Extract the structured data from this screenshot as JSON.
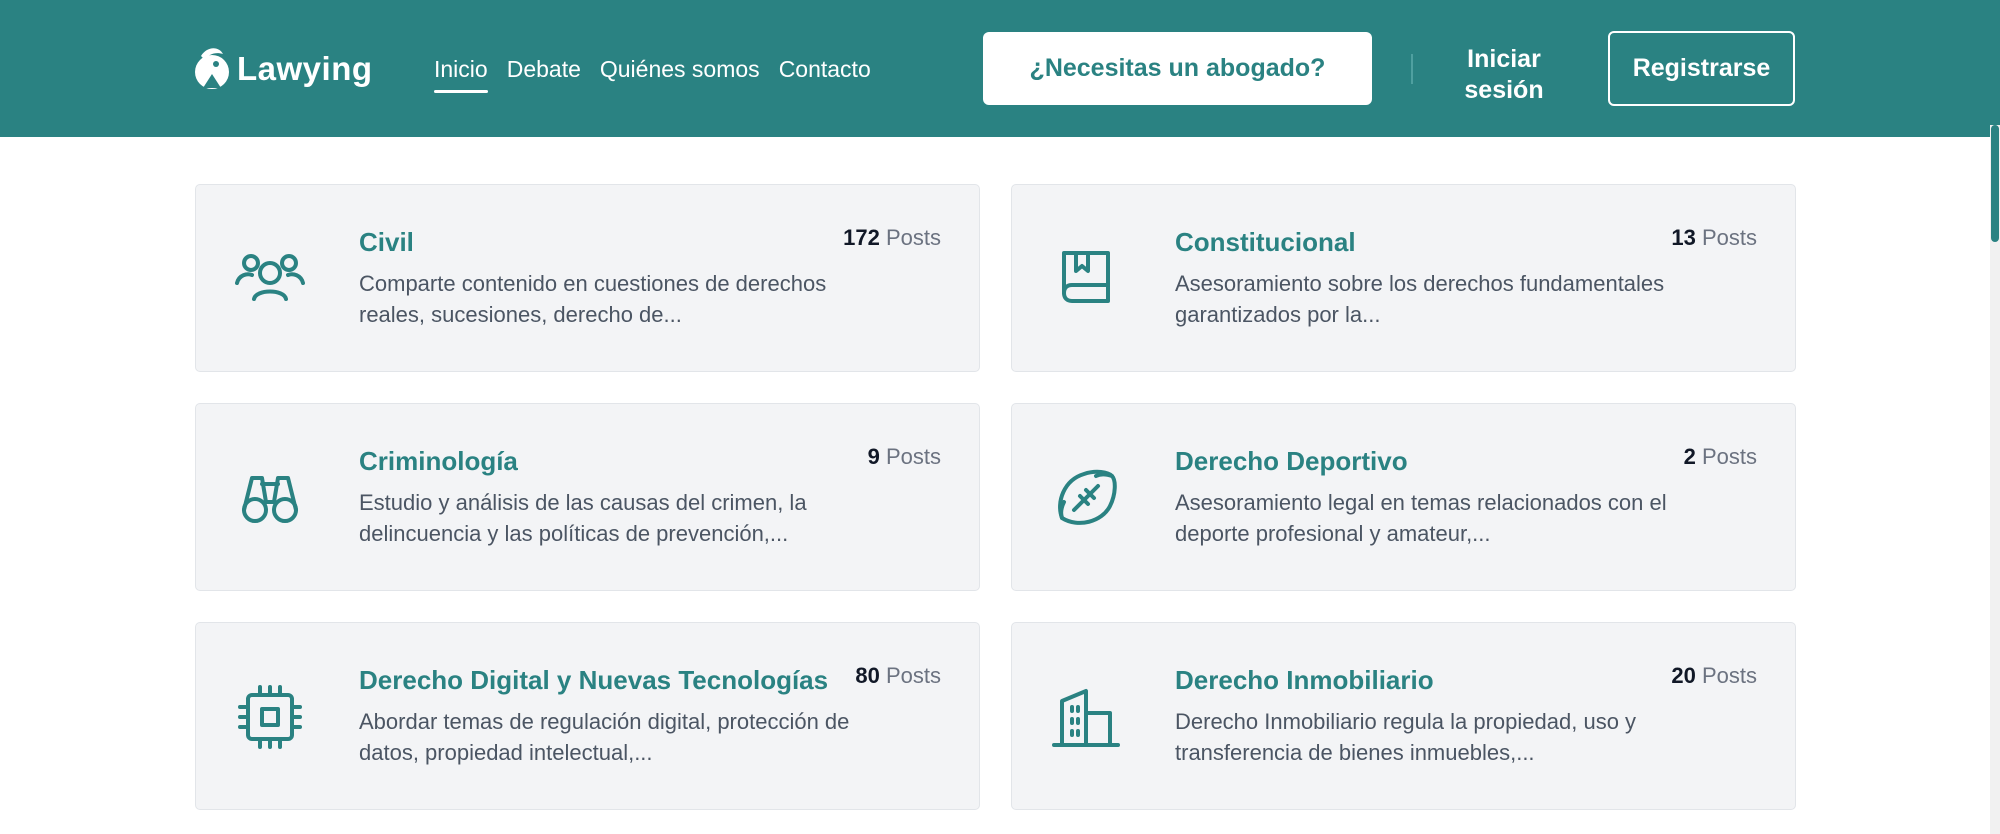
{
  "header": {
    "logo_text": "Lawying",
    "nav": [
      {
        "label": "Inicio",
        "active": true
      },
      {
        "label": "Debate",
        "active": false
      },
      {
        "label": "Quiénes somos",
        "active": false
      },
      {
        "label": "Contacto",
        "active": false
      }
    ],
    "cta_label": "¿Necesitas un abogado?",
    "login_line1": "Iniciar",
    "login_line2": "sesión",
    "register_label": "Registrarse"
  },
  "colors": {
    "brand": "#2a8282",
    "card_bg": "#f3f4f6",
    "text_muted": "#4b5563"
  },
  "posts_label": "Posts",
  "categories": [
    {
      "title": "Civil",
      "count": "172",
      "icon": "users-icon",
      "desc": "Comparte contenido en cuestiones de derechos reales, sucesiones, derecho de..."
    },
    {
      "title": "Constitucional",
      "count": "13",
      "icon": "book-icon",
      "desc": "Asesoramiento sobre los derechos fundamentales garantizados por la..."
    },
    {
      "title": "Criminología",
      "count": "9",
      "icon": "binoculars-icon",
      "desc": "Estudio y análisis de las causas del crimen, la delincuencia y las políticas de prevención,..."
    },
    {
      "title": "Derecho Deportivo",
      "count": "2",
      "icon": "football-icon",
      "desc": "Asesoramiento legal en temas relacionados con el deporte profesional y amateur,..."
    },
    {
      "title": "Derecho Digital y Nuevas Tecnologías",
      "count": "80",
      "icon": "cpu-chip-icon",
      "desc": "Abordar temas de regulación digital, protección de datos, propiedad intelectual,..."
    },
    {
      "title": "Derecho Inmobiliario",
      "count": "20",
      "icon": "building-icon",
      "desc": "Derecho Inmobiliario regula la propiedad, uso y transferencia de bienes inmuebles,..."
    }
  ]
}
